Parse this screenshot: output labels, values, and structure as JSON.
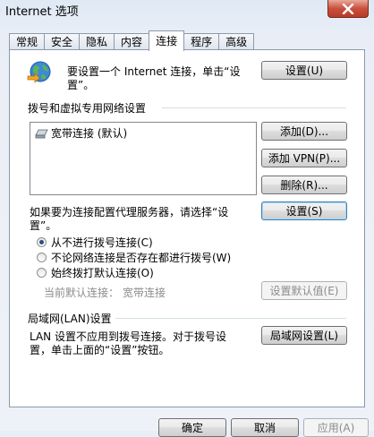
{
  "window": {
    "title": "Internet 选项"
  },
  "tabs": [
    "常规",
    "安全",
    "隐私",
    "内容",
    "连接",
    "程序",
    "高级"
  ],
  "active_tab": "连接",
  "setup": {
    "text_line1": "要设置一个 Internet 连接，单击“设",
    "text_line2": "置”。",
    "button": "设置(U)"
  },
  "dialup": {
    "section_title": "拨号和虚拟专用网络设置",
    "entries": [
      "宽带连接 (默认)"
    ],
    "add_button": "添加(D)...",
    "add_vpn_button": "添加 VPN(P)...",
    "remove_button": "删除(R)...",
    "proxy_text_line1": "如果要为连接配置代理服务器，请选择“设",
    "proxy_text_line2": "置”。",
    "settings_button": "设置(S)",
    "options": [
      {
        "label": "从不进行拨号连接(C)",
        "checked": true
      },
      {
        "label": "不论网络连接是否存在都进行拨号(W)",
        "checked": false
      },
      {
        "label": "始终拨打默认连接(O)",
        "checked": false
      }
    ],
    "current_default_label": "当前默认连接：",
    "current_default_value": "宽带连接",
    "set_default_button": "设置默认值(E)"
  },
  "lan": {
    "section_title": "局域网(LAN)设置",
    "text_line1": "LAN 设置不应用到拨号连接。对于拨号设",
    "text_line2": "置，单击上面的“设置”按钮。",
    "button": "局域网设置(L)"
  },
  "footer": {
    "ok": "确定",
    "cancel": "取消",
    "apply": "应用(A)"
  },
  "colors": {
    "accent": "#2b4f7e",
    "close": "#c9503d"
  }
}
